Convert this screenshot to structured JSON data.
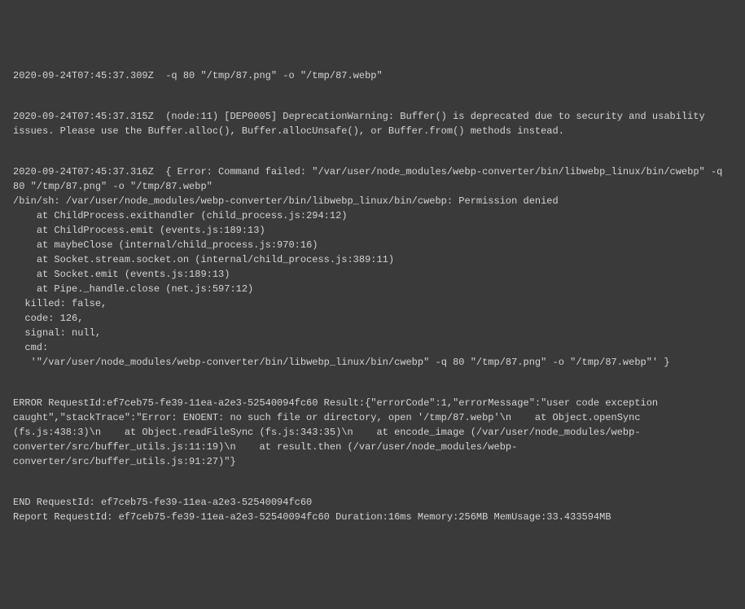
{
  "logs": {
    "block1": "2020-09-24T07:45:37.309Z  -q 80 \"/tmp/87.png\" -o \"/tmp/87.webp\"",
    "block2": "2020-09-24T07:45:37.315Z  (node:11) [DEP0005] DeprecationWarning: Buffer() is deprecated due to security and usability issues. Please use the Buffer.alloc(), Buffer.allocUnsafe(), or Buffer.from() methods instead.",
    "block3": "2020-09-24T07:45:37.316Z  { Error: Command failed: \"/var/user/node_modules/webp-converter/bin/libwebp_linux/bin/cwebp\" -q 80 \"/tmp/87.png\" -o \"/tmp/87.webp\"\n/bin/sh: /var/user/node_modules/webp-converter/bin/libwebp_linux/bin/cwebp: Permission denied\n    at ChildProcess.exithandler (child_process.js:294:12)\n    at ChildProcess.emit (events.js:189:13)\n    at maybeClose (internal/child_process.js:970:16)\n    at Socket.stream.socket.on (internal/child_process.js:389:11)\n    at Socket.emit (events.js:189:13)\n    at Pipe._handle.close (net.js:597:12)\n  killed: false,\n  code: 126,\n  signal: null,\n  cmd:\n   '\"/var/user/node_modules/webp-converter/bin/libwebp_linux/bin/cwebp\" -q 80 \"/tmp/87.png\" -o \"/tmp/87.webp\"' }",
    "block4": "ERROR RequestId:ef7ceb75-fe39-11ea-a2e3-52540094fc60 Result:{\"errorCode\":1,\"errorMessage\":\"user code exception caught\",\"stackTrace\":\"Error: ENOENT: no such file or directory, open '/tmp/87.webp'\\n    at Object.openSync (fs.js:438:3)\\n    at Object.readFileSync (fs.js:343:35)\\n    at encode_image (/var/user/node_modules/webp-converter/src/buffer_utils.js:11:19)\\n    at result.then (/var/user/node_modules/webp-converter/src/buffer_utils.js:91:27)\"}",
    "block5": "END RequestId: ef7ceb75-fe39-11ea-a2e3-52540094fc60\nReport RequestId: ef7ceb75-fe39-11ea-a2e3-52540094fc60 Duration:16ms Memory:256MB MemUsage:33.433594MB"
  }
}
